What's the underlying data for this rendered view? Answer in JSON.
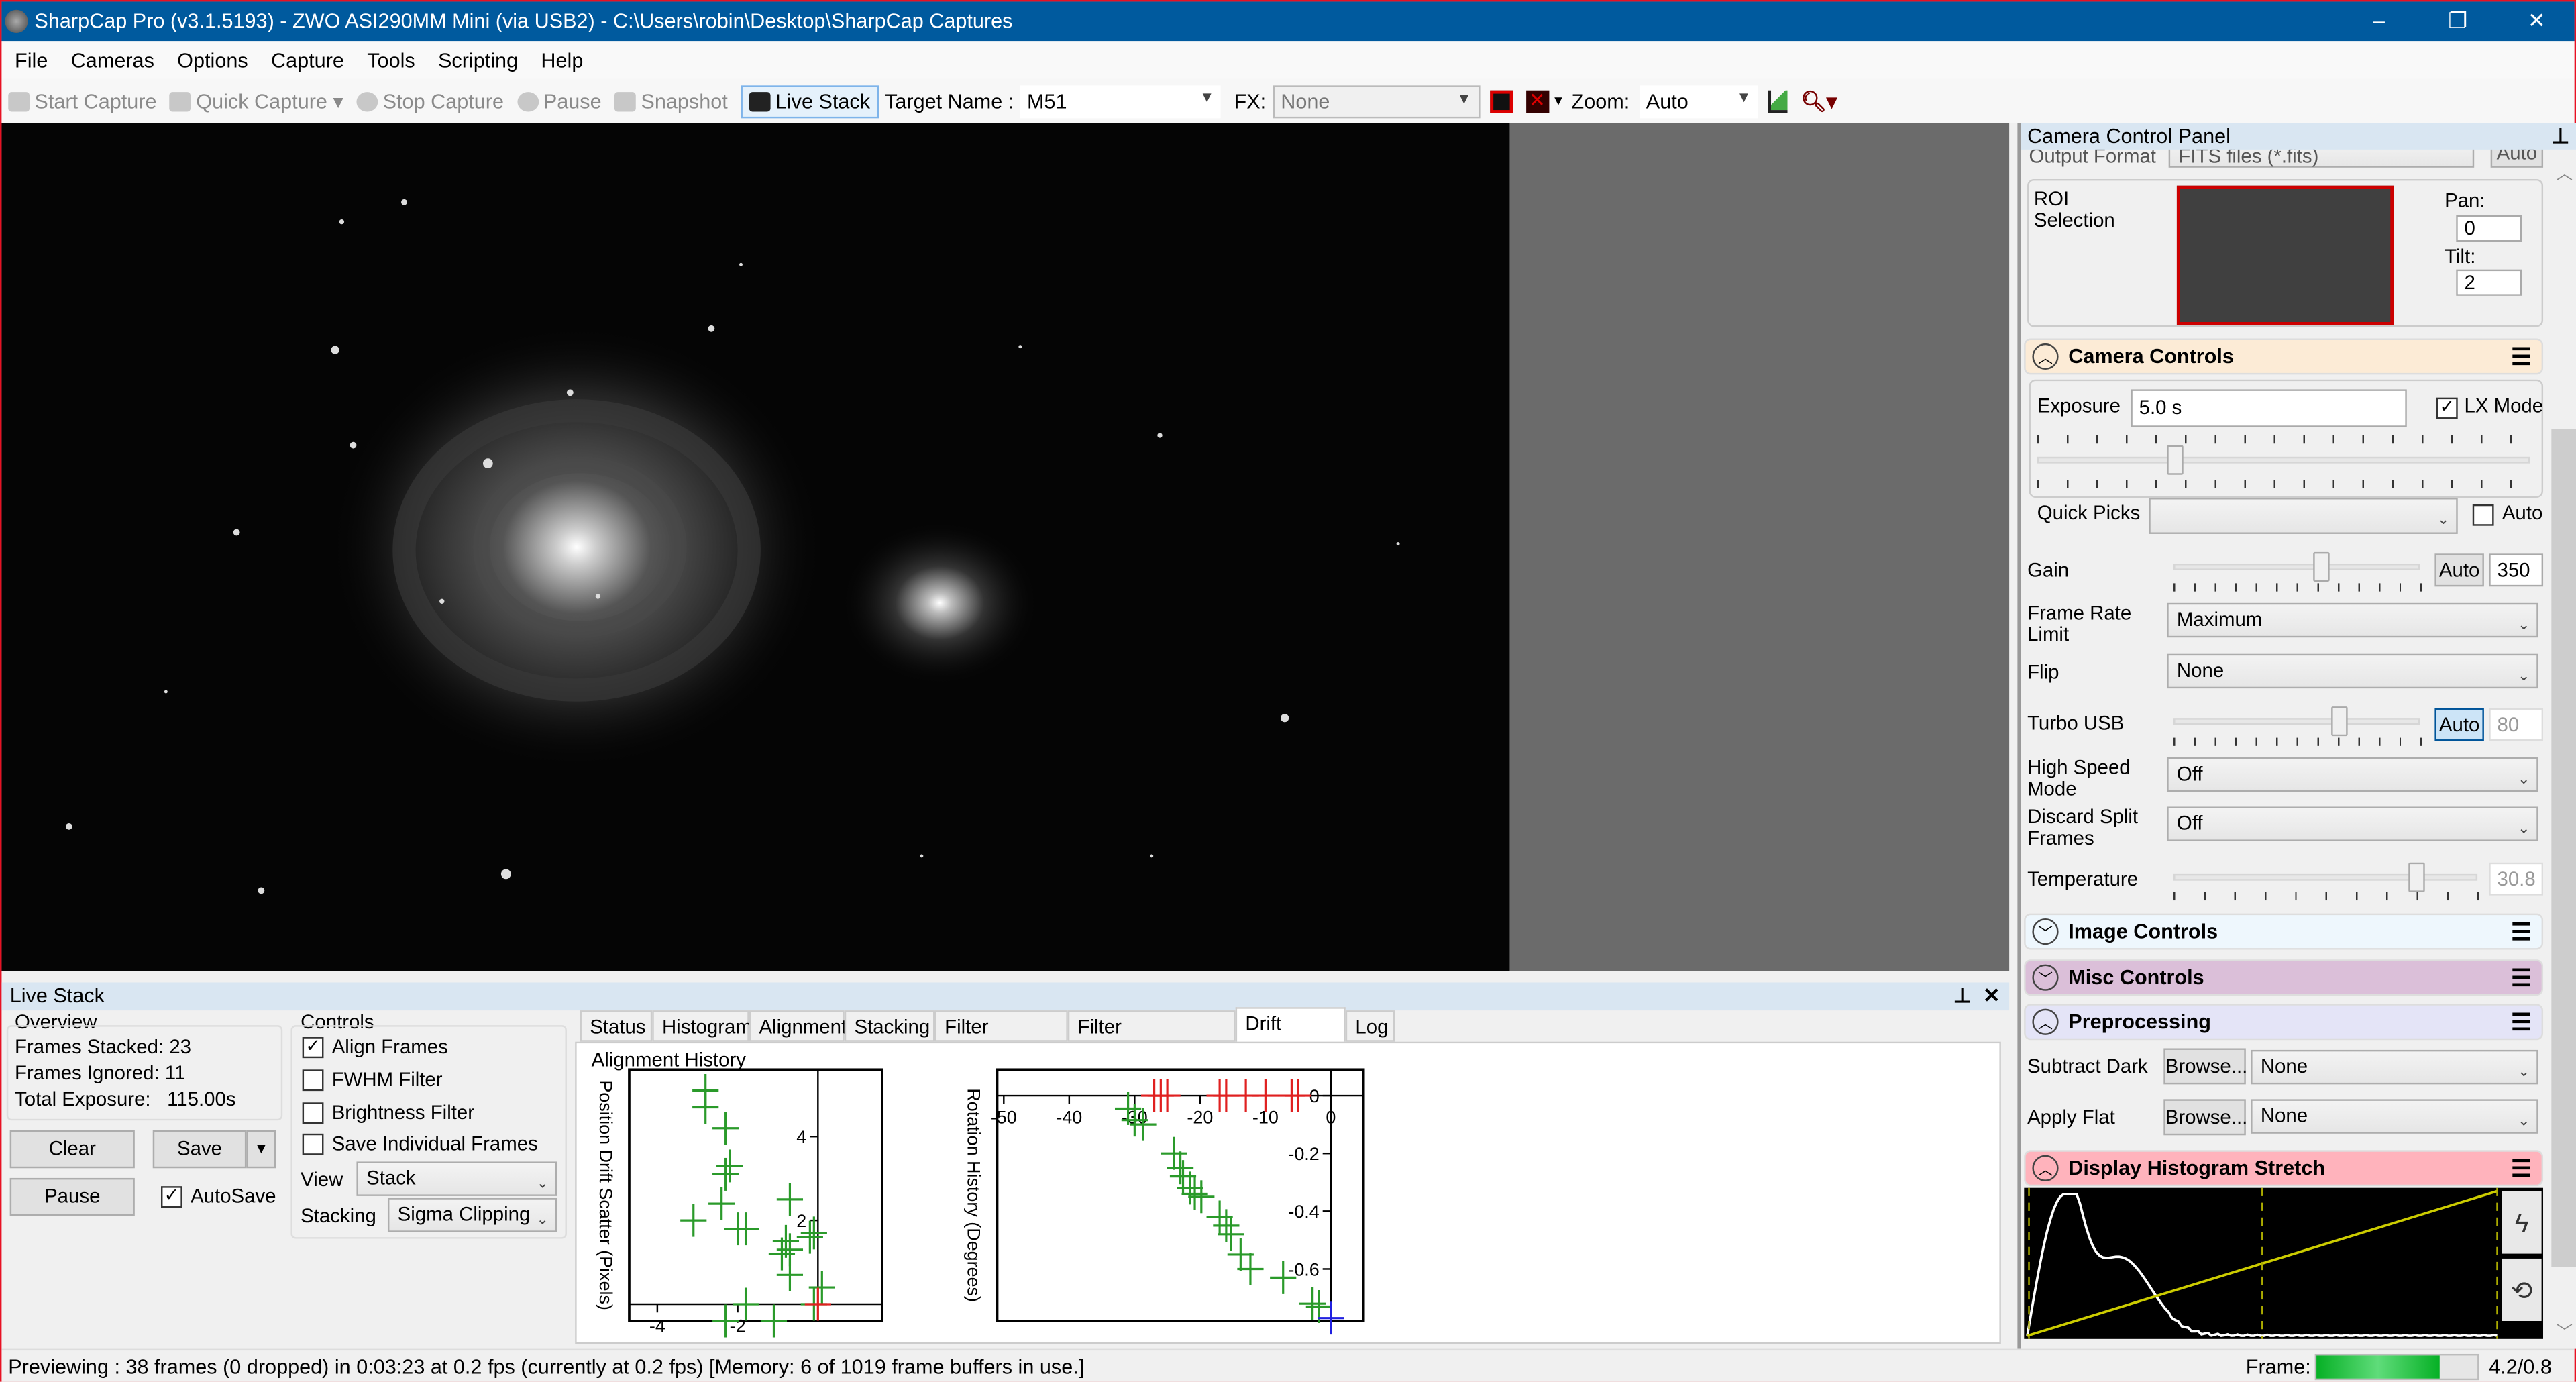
{
  "window": {
    "title": "SharpCap Pro (v3.1.5193) - ZWO ASI290MM Mini (via USB2) - C:\\Users\\robin\\Desktop\\SharpCap Captures",
    "minimize": "–",
    "restore": "❐",
    "close": "✕"
  },
  "menu": [
    "File",
    "Cameras",
    "Options",
    "Capture",
    "Tools",
    "Scripting",
    "Help"
  ],
  "toolbar": {
    "start_capture": "Start Capture",
    "quick_capture": "Quick Capture",
    "stop_capture": "Stop Capture",
    "pause": "Pause",
    "snapshot": "Snapshot",
    "live_stack": "Live Stack",
    "target_label": "Target Name :",
    "target_value": "M51",
    "fx_label": "FX:",
    "fx_value": "None",
    "zoom_label": "Zoom:",
    "zoom_value": "Auto"
  },
  "camera_panel": {
    "title": "Camera Control Panel",
    "output_format_label": "Output Format",
    "output_format_value": "FITS files (*.fits)",
    "output_auto": "Auto",
    "roi_label": "ROI Selection",
    "pan_label": "Pan:",
    "pan_value": "0",
    "tilt_label": "Tilt:",
    "tilt_value": "2",
    "camera_controls": {
      "title": "Camera Controls",
      "color": "#fcebd6",
      "exposure_label": "Exposure",
      "exposure_value": "5.0 s",
      "lx_mode_label": "LX Mode",
      "lx_mode_checked": true,
      "quick_picks_label": "Quick Picks",
      "quick_picks_value": "",
      "quick_auto_label": "Auto",
      "quick_auto_checked": false,
      "gain_label": "Gain",
      "gain_auto": "Auto",
      "gain_value": "350",
      "gain_slider_fraction": 0.6,
      "frame_rate_label": "Frame Rate Limit",
      "frame_rate_value": "Maximum",
      "flip_label": "Flip",
      "flip_value": "None",
      "turbo_label": "Turbo USB",
      "turbo_auto": "Auto",
      "turbo_value": "80",
      "turbo_slider_fraction": 0.67,
      "high_speed_label": "High Speed Mode",
      "high_speed_value": "Off",
      "discard_label": "Discard Split Frames",
      "discard_value": "Off",
      "temperature_label": "Temperature",
      "temperature_value": "30.8",
      "temperature_slider_fraction": 0.8
    },
    "image_controls": {
      "title": "Image Controls",
      "color": "#eef7fd"
    },
    "misc_controls": {
      "title": "Misc Controls",
      "color": "#dbbfd9"
    },
    "preprocessing": {
      "title": "Preprocessing",
      "color": "#e4e4f7",
      "subtract_dark_label": "Subtract Dark",
      "apply_flat_label": "Apply Flat",
      "browse": "Browse...",
      "dark_value": "None",
      "flat_value": "None"
    },
    "histogram": {
      "title": "Display Histogram Stretch",
      "color": "#ffb3bc"
    }
  },
  "live_stack": {
    "title": "Live Stack",
    "overview_label": "Overview",
    "frames_stacked": "Frames Stacked: 23",
    "frames_ignored": "Frames Ignored:  11",
    "total_exposure": "Total Exposure:   115.00s",
    "clear": "Clear",
    "save": "Save",
    "pause": "Pause",
    "autosave": "AutoSave",
    "autosave_checked": true,
    "controls_label": "Controls",
    "align_frames": "Align Frames",
    "fwhm_filter": "FWHM Filter",
    "brightness_filter": "Brightness Filter",
    "save_individual": "Save Individual Frames",
    "view_label": "View",
    "view_value": "Stack",
    "stacking_label": "Stacking",
    "stacking_value": "Sigma Clipping",
    "tabs": [
      "Status",
      "Histogram",
      "Alignment",
      "Stacking",
      "Filter (FWHM)",
      "Filter (Brightness)",
      "Drift Graph",
      "Log"
    ],
    "active_tab": "Drift Graph",
    "group_label": "Alignment History"
  },
  "chart_data": [
    {
      "type": "scatter",
      "ylabel": "Position Drift Scatter (Pixels)",
      "xlim": [
        -4.7,
        1.6
      ],
      "ylim": [
        -0.4,
        5.6
      ],
      "xticks": [
        -4,
        -2
      ],
      "yticks": [
        2,
        4
      ],
      "series": [
        {
          "color": "#2a9a2a",
          "points": [
            [
              -2.8,
              5.1
            ],
            [
              -2.8,
              4.7
            ],
            [
              -2.3,
              4.2
            ],
            [
              -2.2,
              3.3
            ],
            [
              -2.3,
              3.1
            ],
            [
              -2.4,
              2.4
            ],
            [
              -3.1,
              2.0
            ],
            [
              -2.0,
              1.8
            ],
            [
              -1.8,
              1.8
            ],
            [
              -0.7,
              2.5
            ],
            [
              -0.8,
              1.5
            ],
            [
              -0.7,
              1.3
            ],
            [
              -0.9,
              1.2
            ],
            [
              -0.1,
              1.7
            ],
            [
              -0.2,
              1.6
            ],
            [
              -0.7,
              0.7
            ],
            [
              0.1,
              0.4
            ],
            [
              -0.1,
              0.0
            ],
            [
              -1.8,
              0.0
            ],
            [
              -2.3,
              -0.4
            ],
            [
              -1.1,
              -0.4
            ]
          ]
        },
        {
          "color": "#e02020",
          "points": [
            [
              0,
              0
            ]
          ]
        }
      ]
    },
    {
      "type": "scatter",
      "ylabel": "Rotation History (Degrees)",
      "xlim": [
        -51,
        5
      ],
      "ylim": [
        -0.78,
        0.09
      ],
      "xticks": [
        -50,
        -40,
        -30,
        -20,
        -10,
        0
      ],
      "yticks": [
        0,
        -0.2,
        -0.4,
        -0.6
      ],
      "series": [
        {
          "color": "#2a9a2a",
          "points": [
            [
              -31,
              -0.045
            ],
            [
              -30,
              -0.085
            ],
            [
              -28.7,
              -0.1
            ],
            [
              -24,
              -0.2
            ],
            [
              -23,
              -0.25
            ],
            [
              -22.6,
              -0.28
            ],
            [
              -21.5,
              -0.32
            ],
            [
              -20.8,
              -0.34
            ],
            [
              -19.8,
              -0.35
            ],
            [
              -17,
              -0.42
            ],
            [
              -16,
              -0.45
            ],
            [
              -15.3,
              -0.48
            ],
            [
              -13.8,
              -0.55
            ],
            [
              -12.3,
              -0.6
            ],
            [
              -7.3,
              -0.63
            ],
            [
              -2.8,
              -0.72
            ],
            [
              -1.8,
              -0.73
            ]
          ]
        },
        {
          "color": "#e02020",
          "points": [
            [
              -27,
              0
            ],
            [
              -26,
              0
            ],
            [
              -25,
              0
            ],
            [
              -17,
              0
            ],
            [
              -16,
              0
            ],
            [
              -13,
              0
            ],
            [
              -10,
              0
            ],
            [
              -6,
              0
            ],
            [
              -5,
              0
            ]
          ]
        },
        {
          "color": "#2020e0",
          "points": [
            [
              0,
              -0.77
            ]
          ]
        }
      ]
    }
  ],
  "status": {
    "text": "Previewing : 38 frames (0 dropped) in 0:03:23 at 0.2 fps  (currently at 0.2 fps) [Memory: 6 of 1019 frame buffers in use.]",
    "frame_label": "Frame:",
    "frame_fraction": 0.77,
    "frame_value": "4.2/0.8"
  }
}
